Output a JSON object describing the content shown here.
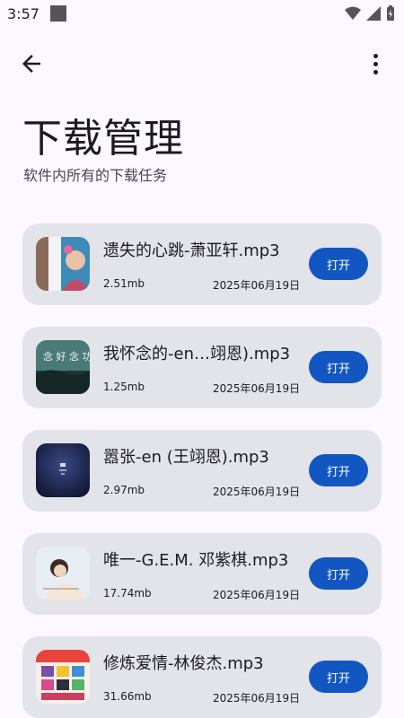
{
  "status_bar": {
    "time": "3:57"
  },
  "header": {
    "title": "下载管理",
    "subtitle": "软件内所有的下载任务"
  },
  "downloads": [
    {
      "filename": "遗失的心跳-萧亚轩.mp3",
      "size": "2.51mb",
      "date": "2025年06月19日",
      "action": "打开"
    },
    {
      "filename": "我怀念的-en…翊恩).mp3",
      "size": "1.25mb",
      "date": "2025年06月19日",
      "action": "打开"
    },
    {
      "filename": "嚣张-en (王翊恩).mp3",
      "size": "2.97mb",
      "date": "2025年06月19日",
      "action": "打开"
    },
    {
      "filename": "唯一-G.E.M. 邓紫棋.mp3",
      "size": "17.74mb",
      "date": "2025年06月19日",
      "action": "打开"
    },
    {
      "filename": "修炼爱情-林俊杰.mp3",
      "size": "31.66mb",
      "date": "2025年06月19日",
      "action": "打开"
    }
  ],
  "colors": {
    "accent": "#1257c1",
    "card_bg": "#e3e3ea",
    "page_bg": "#fdf8ff"
  }
}
